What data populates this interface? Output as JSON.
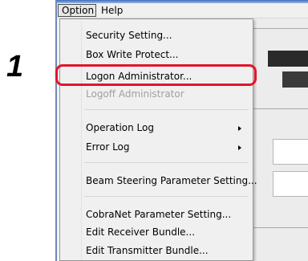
{
  "step": {
    "number": "1"
  },
  "menubar": {
    "items": [
      {
        "label": "Option",
        "active": true
      },
      {
        "label": "Help",
        "active": false
      }
    ]
  },
  "menu": {
    "items": [
      {
        "label": "Security Setting...",
        "enabled": true
      },
      {
        "label": "Box Write Protect...",
        "enabled": true
      },
      {
        "label": "Logon Administrator...",
        "enabled": true,
        "highlighted": true
      },
      {
        "label": "Logoff Administrator",
        "enabled": false
      },
      {
        "label": "Operation Log",
        "enabled": true,
        "submenu": true
      },
      {
        "label": "Error Log",
        "enabled": true,
        "submenu": true
      },
      {
        "label": "Beam Steering Parameter Setting...",
        "enabled": true
      },
      {
        "label": "CobraNet Parameter Setting...",
        "enabled": true
      },
      {
        "label": "Edit Receiver Bundle...",
        "enabled": true
      },
      {
        "label": "Edit Transmitter Bundle...",
        "enabled": true
      }
    ]
  },
  "colors": {
    "highlight_outline": "#e1152b",
    "menu_background": "#f0f0f0",
    "disabled_text": "#a0a0a0"
  }
}
